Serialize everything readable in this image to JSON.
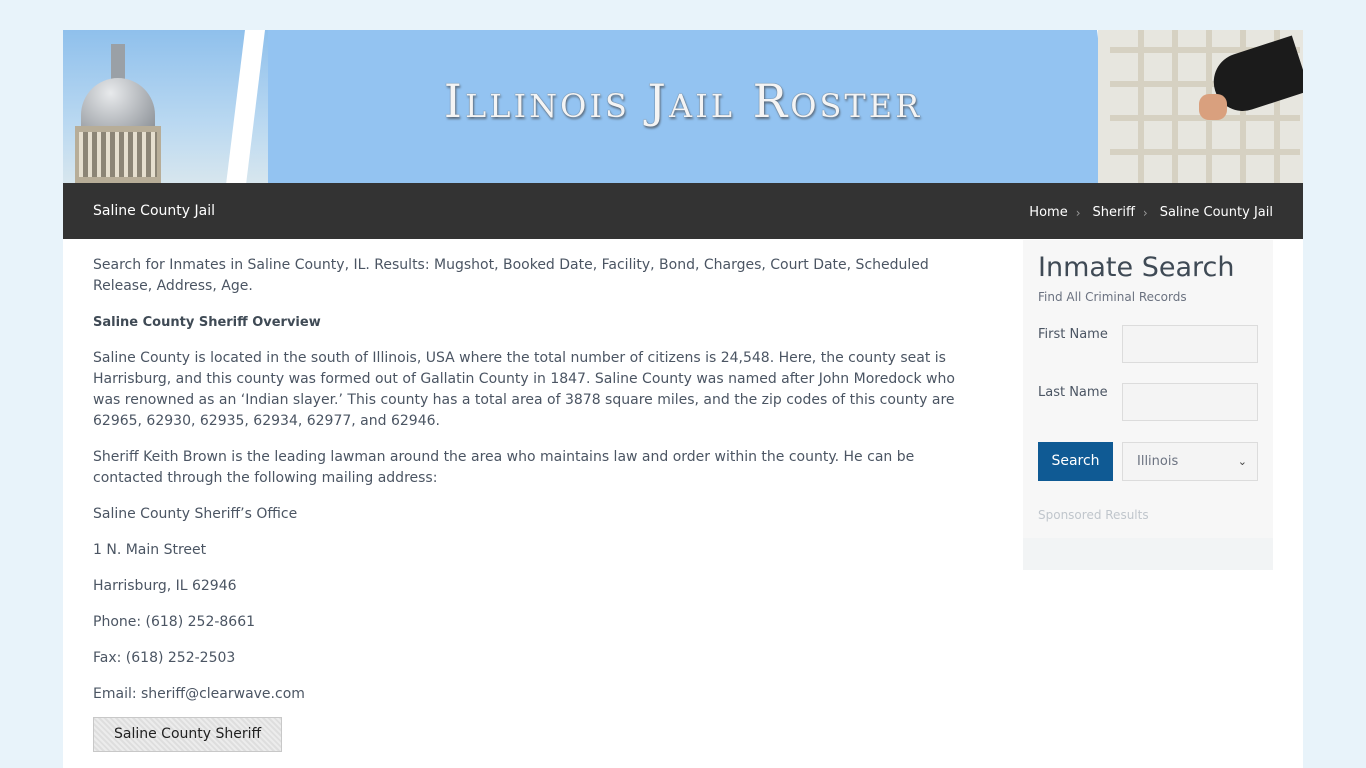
{
  "banner": {
    "title": "Illinois Jail Roster"
  },
  "titlebar": {
    "page_title": "Saline County Jail",
    "breadcrumbs": [
      {
        "label": "Home"
      },
      {
        "label": "Sheriff"
      },
      {
        "label": "Saline County Jail"
      }
    ]
  },
  "main": {
    "intro": "Search for Inmates in Saline County, IL. Results: Mugshot, Booked Date, Facility, Bond, Charges, Court Date, Scheduled Release, Address, Age.",
    "overview_heading": "Saline County Sheriff Overview",
    "para1": "Saline County is located in the south of Illinois, USA where the total number of citizens is 24,548. Here, the county seat is Harrisburg, and this county was formed out of Gallatin County in 1847. Saline County was named after John Moredock who was renowned as an ‘Indian slayer.’ This county has a total area of 3878 square miles, and the zip codes of this county are 62965, 62930, 62935, 62934, 62977, and 62946.",
    "para2": "Sheriff Keith Brown is the leading lawman around the area who maintains law and order within the county. He can be contacted through the following mailing address:",
    "office": "Saline County Sheriff’s Office",
    "street": "1 N. Main Street",
    "city": "Harrisburg, IL 62946",
    "phone": "Phone: (618) 252-8661",
    "fax": "Fax: (618) 252-2503",
    "email": "Email: sheriff@clearwave.com",
    "sheriff_button": "Saline County Sheriff"
  },
  "sidebar": {
    "heading": "Inmate Search",
    "subheading": "Find All Criminal Records",
    "first_name_label": "First Name",
    "last_name_label": "Last Name",
    "search_button": "Search",
    "state_select": "Illinois",
    "sponsored": "Sponsored Results"
  },
  "colors": {
    "page_bg": "#e8f3fa",
    "banner_blue": "#93c3f1",
    "titlebar": "#333333",
    "search_button": "#0f5a94"
  }
}
